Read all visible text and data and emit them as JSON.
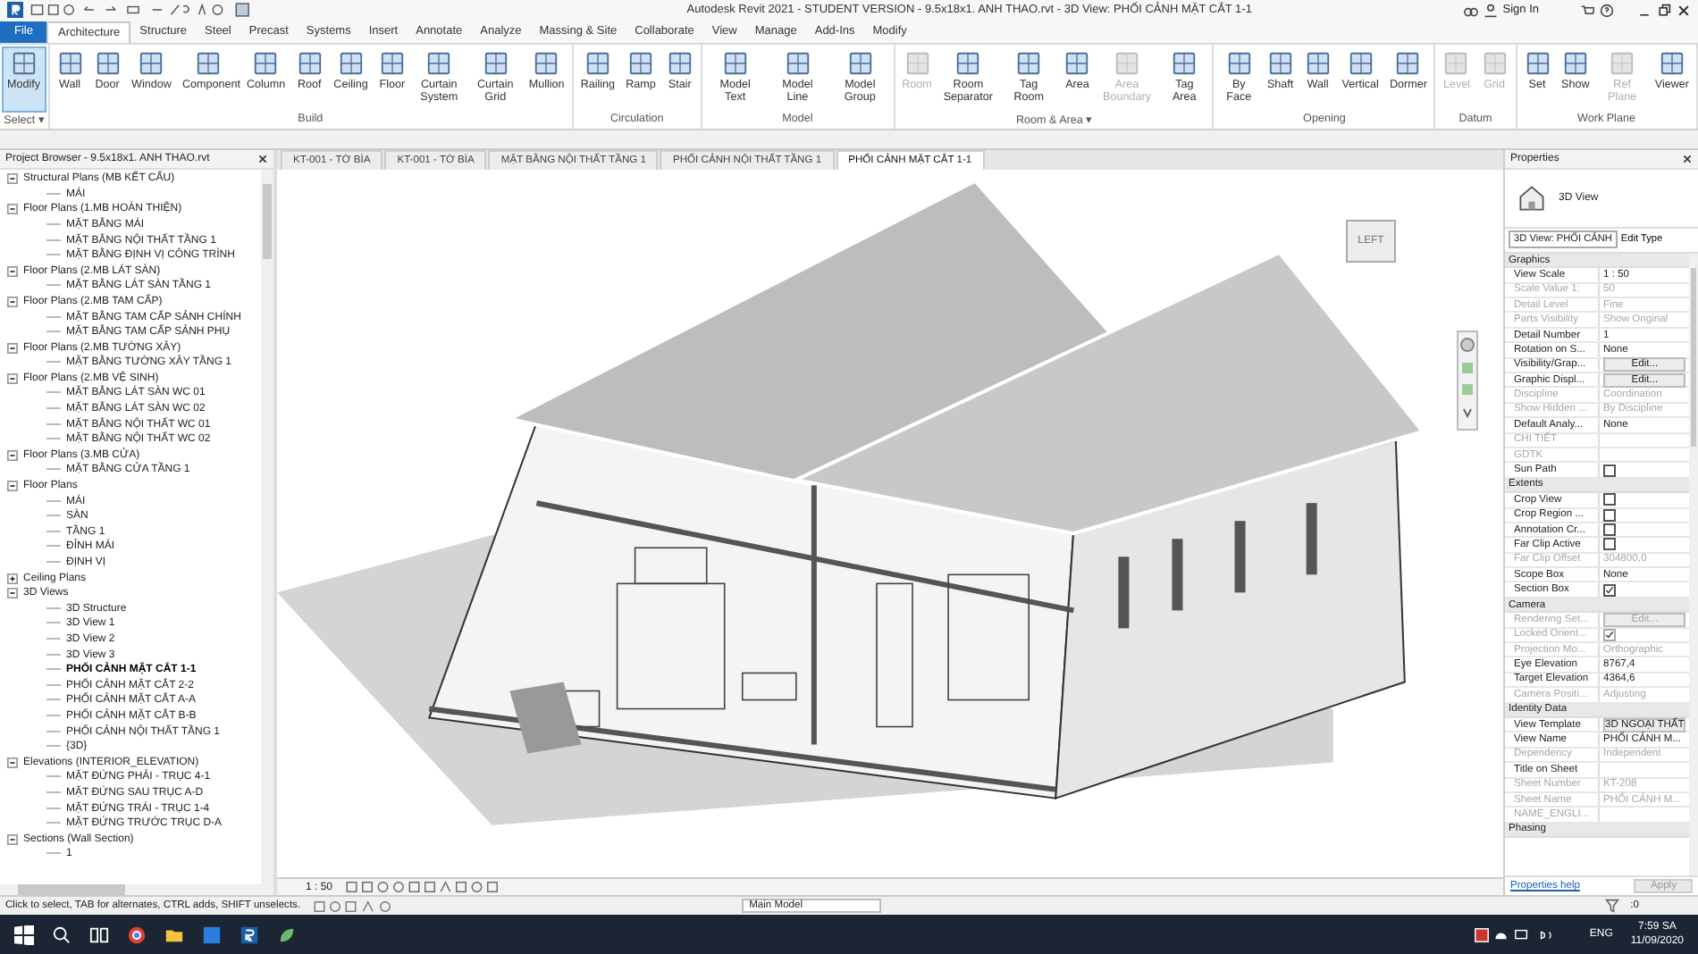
{
  "title_bar": {
    "title": "Autodesk Revit 2021 - STUDENT VERSION - 9.5x18x1. ANH THAO.rvt - 3D View: PHỐI CẢNH MẶT CẮT 1-1",
    "sign_in": "Sign In"
  },
  "ribbon_tabs": [
    {
      "label": "File",
      "kind": "file",
      "selected": false
    },
    {
      "label": "Architecture",
      "kind": "tab",
      "selected": true
    },
    {
      "label": "Structure",
      "kind": "tab",
      "selected": false
    },
    {
      "label": "Steel",
      "kind": "tab",
      "selected": false
    },
    {
      "label": "Precast",
      "kind": "tab",
      "selected": false
    },
    {
      "label": "Systems",
      "kind": "tab",
      "selected": false
    },
    {
      "label": "Insert",
      "kind": "tab",
      "selected": false
    },
    {
      "label": "Annotate",
      "kind": "tab",
      "selected": false
    },
    {
      "label": "Analyze",
      "kind": "tab",
      "selected": false
    },
    {
      "label": "Massing & Site",
      "kind": "tab",
      "selected": false
    },
    {
      "label": "Collaborate",
      "kind": "tab",
      "selected": false
    },
    {
      "label": "View",
      "kind": "tab",
      "selected": false
    },
    {
      "label": "Manage",
      "kind": "tab",
      "selected": false
    },
    {
      "label": "Add-Ins",
      "kind": "tab",
      "selected": false
    },
    {
      "label": "Modify",
      "kind": "tab",
      "selected": false
    }
  ],
  "ribbon_groups": [
    {
      "label": "Select ▾",
      "buttons": [
        {
          "label": "Modify",
          "selected": true,
          "disabled": false
        }
      ]
    },
    {
      "label": "Build",
      "buttons": [
        {
          "label": "Wall",
          "selected": false,
          "disabled": false
        },
        {
          "label": "Door",
          "selected": false,
          "disabled": false
        },
        {
          "label": "Window",
          "selected": false,
          "disabled": false
        },
        {
          "label": "Component",
          "selected": false,
          "disabled": false
        },
        {
          "label": "Column",
          "selected": false,
          "disabled": false
        },
        {
          "label": "Roof",
          "selected": false,
          "disabled": false
        },
        {
          "label": "Ceiling",
          "selected": false,
          "disabled": false
        },
        {
          "label": "Floor",
          "selected": false,
          "disabled": false
        },
        {
          "label": "Curtain System",
          "selected": false,
          "disabled": false
        },
        {
          "label": "Curtain Grid",
          "selected": false,
          "disabled": false
        },
        {
          "label": "Mullion",
          "selected": false,
          "disabled": false
        }
      ]
    },
    {
      "label": "Circulation",
      "buttons": [
        {
          "label": "Railing",
          "selected": false,
          "disabled": false
        },
        {
          "label": "Ramp",
          "selected": false,
          "disabled": false
        },
        {
          "label": "Stair",
          "selected": false,
          "disabled": false
        }
      ]
    },
    {
      "label": "Model",
      "buttons": [
        {
          "label": "Model Text",
          "selected": false,
          "disabled": false
        },
        {
          "label": "Model Line",
          "selected": false,
          "disabled": false
        },
        {
          "label": "Model Group",
          "selected": false,
          "disabled": false
        }
      ]
    },
    {
      "label": "Room & Area ▾",
      "buttons": [
        {
          "label": "Room",
          "selected": false,
          "disabled": true
        },
        {
          "label": "Room Separator",
          "selected": false,
          "disabled": false
        },
        {
          "label": "Tag Room",
          "selected": false,
          "disabled": false
        },
        {
          "label": "Area",
          "selected": false,
          "disabled": false
        },
        {
          "label": "Area Boundary",
          "selected": false,
          "disabled": true
        },
        {
          "label": "Tag Area",
          "selected": false,
          "disabled": false
        }
      ]
    },
    {
      "label": "Opening",
      "buttons": [
        {
          "label": "By Face",
          "selected": false,
          "disabled": false
        },
        {
          "label": "Shaft",
          "selected": false,
          "disabled": false
        },
        {
          "label": "Wall",
          "selected": false,
          "disabled": false
        },
        {
          "label": "Vertical",
          "selected": false,
          "disabled": false
        },
        {
          "label": "Dormer",
          "selected": false,
          "disabled": false
        }
      ]
    },
    {
      "label": "Datum",
      "buttons": [
        {
          "label": "Level",
          "selected": false,
          "disabled": true
        },
        {
          "label": "Grid",
          "selected": false,
          "disabled": true
        }
      ]
    },
    {
      "label": "Work Plane",
      "buttons": [
        {
          "label": "Set",
          "selected": false,
          "disabled": false
        },
        {
          "label": "Show",
          "selected": false,
          "disabled": false
        },
        {
          "label": "Ref Plane",
          "selected": false,
          "disabled": true
        },
        {
          "label": "Viewer",
          "selected": false,
          "disabled": false
        }
      ]
    }
  ],
  "project_browser": {
    "title": "Project Browser - 9.5x18x1. ANH THAO.rvt",
    "items": [
      {
        "label": "Structural Plans (MB KẾT CẤU)",
        "expanded": true,
        "children": [
          {
            "label": "MÁI",
            "selected": false
          }
        ]
      },
      {
        "label": "Floor Plans (1.MB HOÀN THIỆN)",
        "expanded": true,
        "children": [
          {
            "label": "MẶT BẰNG MÁI",
            "selected": false
          },
          {
            "label": "MẶT BẰNG NỘI THẤT TẦNG 1",
            "selected": false
          },
          {
            "label": "MẶT BẰNG ĐỊNH VỊ CÔNG TRÌNH",
            "selected": false
          }
        ]
      },
      {
        "label": "Floor Plans (2.MB LÁT SÀN)",
        "expanded": true,
        "children": [
          {
            "label": "MẶT BẰNG LÁT SÀN TẦNG 1",
            "selected": false
          }
        ]
      },
      {
        "label": "Floor Plans (2.MB TAM CẤP)",
        "expanded": true,
        "children": [
          {
            "label": "MẶT BẰNG TAM CẤP SẢNH CHÍNH",
            "selected": false
          },
          {
            "label": "MẶT BẰNG TAM CẤP SẢNH PHỤ",
            "selected": false
          }
        ]
      },
      {
        "label": "Floor Plans (2.MB TƯỜNG XÂY)",
        "expanded": true,
        "children": [
          {
            "label": "MẶT BẰNG TƯỜNG XÂY TẦNG 1",
            "selected": false
          }
        ]
      },
      {
        "label": "Floor Plans (2.MB VỆ SINH)",
        "expanded": true,
        "children": [
          {
            "label": "MẶT BẰNG LÁT SÀN WC 01",
            "selected": false
          },
          {
            "label": "MẶT BẰNG LÁT SÀN WC 02",
            "selected": false
          },
          {
            "label": "MẶT BẰNG NỘI THẤT WC 01",
            "selected": false
          },
          {
            "label": "MẶT BẰNG NỘI THẤT WC 02",
            "selected": false
          }
        ]
      },
      {
        "label": "Floor Plans (3.MB CỬA)",
        "expanded": true,
        "children": [
          {
            "label": "MẶT BẰNG CỬA TẦNG 1",
            "selected": false
          }
        ]
      },
      {
        "label": "Floor Plans",
        "expanded": true,
        "children": [
          {
            "label": "MÁI",
            "selected": false
          },
          {
            "label": "SÀN",
            "selected": false
          },
          {
            "label": "TẦNG 1",
            "selected": false
          },
          {
            "label": "ĐỈNH MÁI",
            "selected": false
          },
          {
            "label": "ĐỊNH VỊ",
            "selected": false
          }
        ]
      },
      {
        "label": "Ceiling Plans",
        "expanded": false
      },
      {
        "label": "3D Views",
        "expanded": true,
        "children": [
          {
            "label": "3D Structure",
            "selected": false
          },
          {
            "label": "3D View 1",
            "selected": false
          },
          {
            "label": "3D View 2",
            "selected": false
          },
          {
            "label": "3D View 3",
            "selected": false
          },
          {
            "label": "PHỐI CẢNH MẶT CẮT 1-1",
            "selected": true
          },
          {
            "label": "PHỐI CẢNH MẶT CẮT 2-2",
            "selected": false
          },
          {
            "label": "PHỐI CẢNH MẶT CẮT A-A",
            "selected": false
          },
          {
            "label": "PHỐI CẢNH MẶT CẮT B-B",
            "selected": false
          },
          {
            "label": "PHỐI CẢNH NỘI THẤT TẦNG 1",
            "selected": false
          },
          {
            "label": "{3D}",
            "selected": false
          }
        ]
      },
      {
        "label": "Elevations (INTERIOR_ELEVATION)",
        "expanded": true,
        "children": [
          {
            "label": "MẶT ĐỨNG PHẢI - TRỤC 4-1",
            "selected": false
          },
          {
            "label": "MẶT ĐỨNG SAU TRỤC A-D",
            "selected": false
          },
          {
            "label": "MẶT ĐỨNG TRÁI - TRỤC 1-4",
            "selected": false
          },
          {
            "label": "MẶT ĐỨNG TRƯỚC TRỤC D-A",
            "selected": false
          }
        ]
      },
      {
        "label": "Sections (Wall Section)",
        "expanded": true,
        "children": [
          {
            "label": "1",
            "selected": false
          }
        ]
      }
    ]
  },
  "view_tabs": [
    {
      "label": "KT-001 - TỜ BÌA",
      "selected": false
    },
    {
      "label": "KT-001 - TỜ BÌA",
      "selected": false
    },
    {
      "label": "MẶT BẰNG NỘI THẤT TẦNG 1",
      "selected": false
    },
    {
      "label": "PHỐI CẢNH NỘI THẤT TẦNG 1",
      "selected": false
    },
    {
      "label": "PHỐI CẢNH MẶT CẮT 1-1",
      "selected": true
    }
  ],
  "view_cube": {
    "face": "LEFT"
  },
  "view_control_bar": {
    "scale": "1 : 50"
  },
  "properties": {
    "title": "Properties",
    "type_name": "3D View",
    "type_selector": "3D View: PHỐI CẢNH",
    "edit_type": "Edit Type",
    "rows": [
      {
        "kind": "section",
        "label": "Graphics"
      },
      {
        "kind": "text",
        "label": "View Scale",
        "value": "1 : 50",
        "disabled": false
      },
      {
        "kind": "text",
        "label": "Scale Value    1:",
        "value": "50",
        "disabled": true
      },
      {
        "kind": "text",
        "label": "Detail Level",
        "value": "Fine",
        "disabled": true
      },
      {
        "kind": "text",
        "label": "Parts Visibility",
        "value": "Show Original",
        "disabled": true
      },
      {
        "kind": "text",
        "label": "Detail Number",
        "value": "1",
        "disabled": false
      },
      {
        "kind": "text",
        "label": "Rotation on S...",
        "value": "None",
        "disabled": false
      },
      {
        "kind": "button",
        "label": "Visibility/Grap...",
        "value": "Edit...",
        "disabled": false
      },
      {
        "kind": "button",
        "label": "Graphic Displ...",
        "value": "Edit...",
        "disabled": false
      },
      {
        "kind": "text",
        "label": "Discipline",
        "value": "Coordination",
        "disabled": true
      },
      {
        "kind": "text",
        "label": "Show Hidden ...",
        "value": "By Discipline",
        "disabled": true
      },
      {
        "kind": "text",
        "label": "Default Analy...",
        "value": "None",
        "disabled": false
      },
      {
        "kind": "text",
        "label": "CHI TIẾT",
        "disabled": true
      },
      {
        "kind": "text",
        "label": "GDTK",
        "disabled": true
      },
      {
        "kind": "checkbox",
        "label": "Sun Path",
        "checked": false,
        "disabled": false
      },
      {
        "kind": "section",
        "label": "Extents"
      },
      {
        "kind": "checkbox",
        "label": "Crop View",
        "checked": false,
        "disabled": false
      },
      {
        "kind": "checkbox",
        "label": "Crop Region ...",
        "checked": false,
        "disabled": false
      },
      {
        "kind": "checkbox",
        "label": "Annotation Cr...",
        "checked": false,
        "disabled": false
      },
      {
        "kind": "checkbox",
        "label": "Far Clip Active",
        "checked": false,
        "disabled": false
      },
      {
        "kind": "text",
        "label": "Far Clip Offset",
        "value": "304800,0",
        "disabled": true
      },
      {
        "kind": "text",
        "label": "Scope Box",
        "value": "None",
        "disabled": false
      },
      {
        "kind": "checkbox",
        "label": "Section Box",
        "checked": true,
        "disabled": false
      },
      {
        "kind": "section",
        "label": "Camera"
      },
      {
        "kind": "button",
        "label": "Rendering Set...",
        "value": "Edit...",
        "disabled": true
      },
      {
        "kind": "checkbox",
        "label": "Locked Orient...",
        "checked": true,
        "disabled": true
      },
      {
        "kind": "text",
        "label": "Projection Mo...",
        "value": "Orthographic",
        "disabled": true
      },
      {
        "kind": "text",
        "label": "Eye Elevation",
        "value": "8767,4",
        "disabled": false
      },
      {
        "kind": "text",
        "label": "Target Elevation",
        "value": "4364,6",
        "disabled": false
      },
      {
        "kind": "text",
        "label": "Camera Positi...",
        "value": "Adjusting",
        "disabled": true
      },
      {
        "kind": "section",
        "label": "Identity Data"
      },
      {
        "kind": "button",
        "label": "View Template",
        "value": "3D NGOẠI THẤT",
        "disabled": false
      },
      {
        "kind": "text",
        "label": "View Name",
        "value": "PHỐI CẢNH M...",
        "disabled": false
      },
      {
        "kind": "text",
        "label": "Dependency",
        "value": "Independent",
        "disabled": true
      },
      {
        "kind": "text",
        "label": "Title on Sheet",
        "disabled": false
      },
      {
        "kind": "text",
        "label": "Sheet Number",
        "value": "KT-208",
        "disabled": true
      },
      {
        "kind": "text",
        "label": "Sheet Name",
        "value": "PHỐI CẢNH M...",
        "disabled": true
      },
      {
        "kind": "text",
        "label": "NAME_ENGLI...",
        "disabled": true
      },
      {
        "kind": "section",
        "label": "Phasing"
      }
    ],
    "help_link": "Properties help",
    "apply": "Apply"
  },
  "status_bar": {
    "message": "Click to select, TAB for alternates, CTRL adds, SHIFT unselects.",
    "model": "Main Model",
    "filter_count": ":0"
  },
  "taskbar": {
    "language": "ENG",
    "time": "7:59 SA",
    "date": "11/09/2020"
  }
}
